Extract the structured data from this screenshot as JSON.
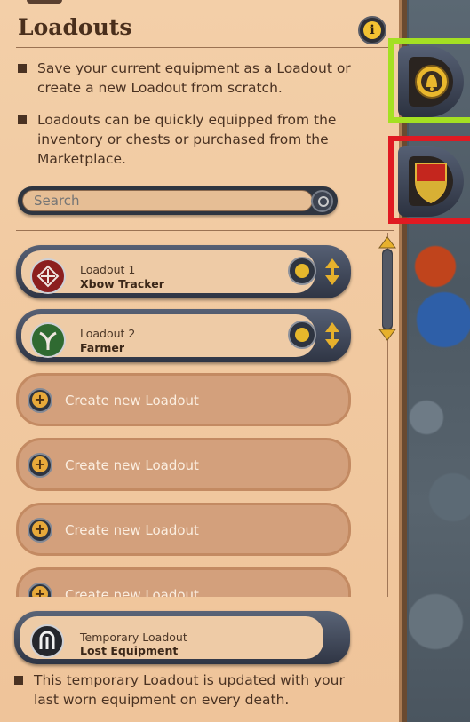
{
  "panel": {
    "title": "Loadouts",
    "bullets": [
      "Save your current equipment as a Loadout or create a new Loadout from scratch.",
      "Loadouts can be quickly equipped from the inventory or chests or purchased from the Marketplace."
    ],
    "search_placeholder": "Search"
  },
  "loadouts": [
    {
      "label": "Loadout 1",
      "name": "Xbow Tracker",
      "icon": "crossbow-icon"
    },
    {
      "label": "Loadout 2",
      "name": "Farmer",
      "icon": "sickle-icon"
    }
  ],
  "create_slots": [
    "Create new Loadout",
    "Create new Loadout",
    "Create new Loadout",
    "Create new Loadout"
  ],
  "temporary": {
    "label": "Temporary Loadout",
    "name": "Lost Equipment",
    "note": "This temporary Loadout is updated with your last worn equipment on every death."
  },
  "side_tabs": [
    {
      "icon": "bell-icon",
      "highlight": "#a4e022"
    },
    {
      "icon": "shield-icon",
      "highlight": "#e01a22"
    }
  ]
}
